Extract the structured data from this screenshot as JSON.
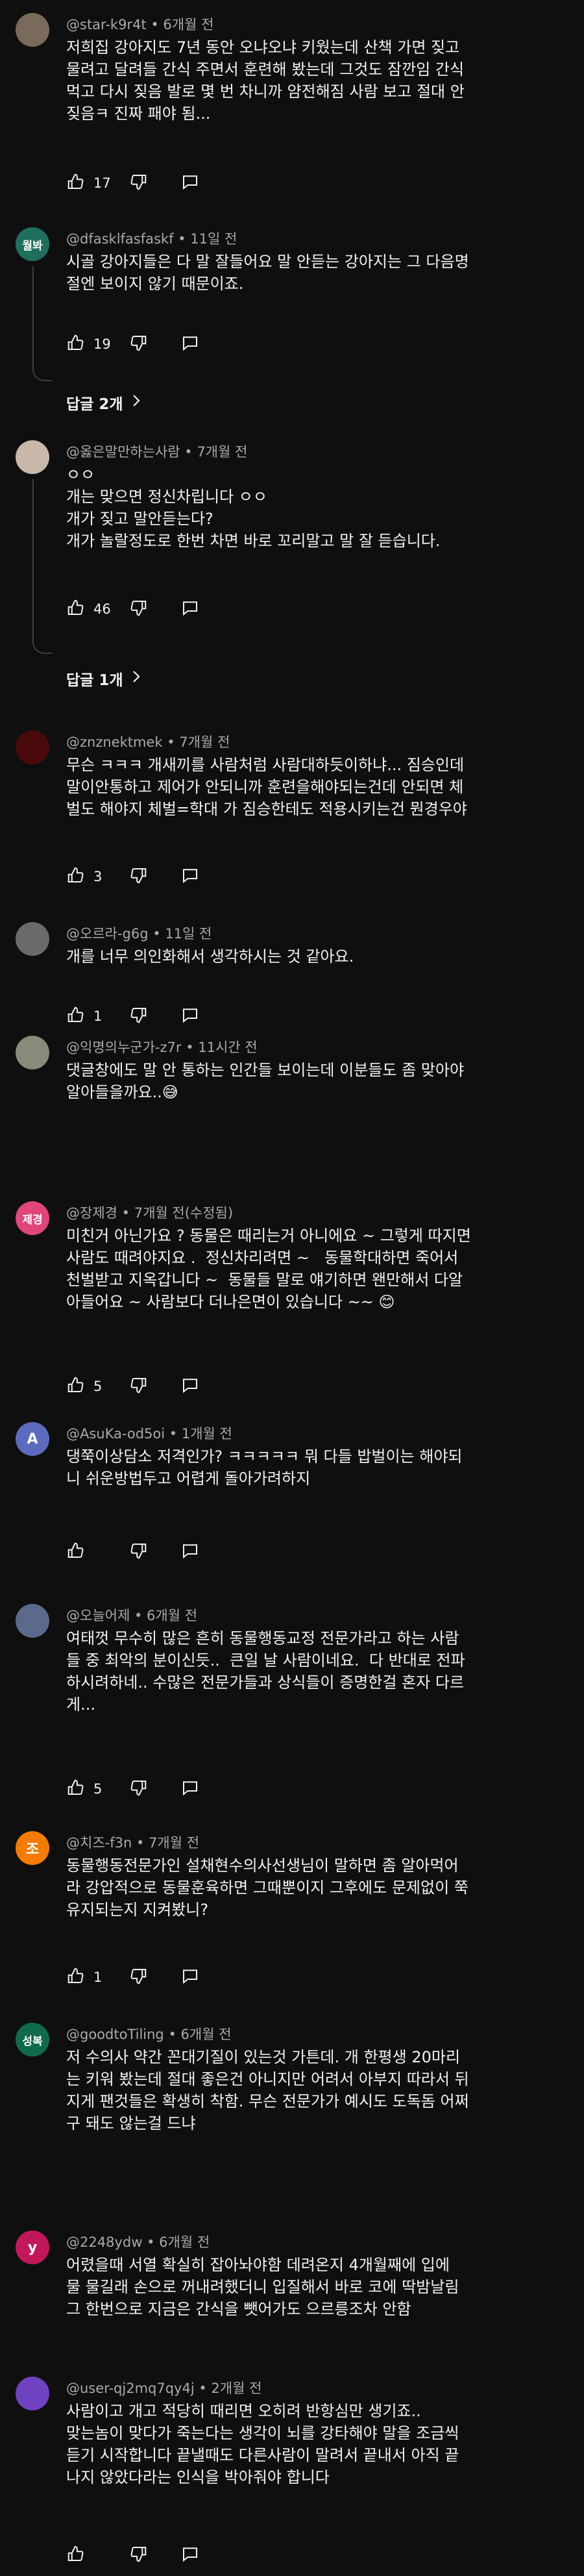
{
  "comments": [
    {
      "author": "@star-k9r4t",
      "time": "6개월 전",
      "avatar_text": "",
      "avatar_color": "#7a6a5a",
      "text": "저희집 강아지도 7년 동안 오냐오냐 키웠는데 산책 가면 짖고\n물려고 달려들 간식 주면서 훈련해 봤는데 그것도 잠깐임 간식\n먹고 다시 짖음 발로 몇 번 차니까 얌전해짐 사람 보고 절대 안\n짖음ㅋ 진짜 패야 됨...",
      "likes": "17"
    },
    {
      "author": "@dfasklfasfaskf",
      "time": "11일 전",
      "avatar_text": "월봐",
      "avatar_color": "#1f6f5f",
      "text": "시골 강아지들은 다 말 잘들어요 말 안듣는 강아지는 그 다음명\n절엔 보이지 않기 때문이죠.",
      "likes": "19",
      "replies": "답글 2개"
    },
    {
      "author": "@옳은말만하는사람",
      "time": "7개월 전",
      "avatar_text": "",
      "avatar_color": "#c8b8a8",
      "text": "ㅇㅇ\n개는 맞으면 정신차립니다 ㅇㅇ\n개가 짖고 말안듣는다?\n개가 놀랄정도로 한번 차면 바로 꼬리말고 말 잘 듣습니다.",
      "likes": "46",
      "replies": "답글 1개"
    },
    {
      "author": "@znznektmek",
      "time": "7개월 전",
      "avatar_text": "",
      "avatar_color": "#4a0a0a",
      "text": "무슨 ㅋㅋㅋ 개새끼를 사람처럼 사람대하듯이하냐... 짐승인데\n말이안통하고 제어가 안되니까 훈련을해야되는건데 안되면 체\n벌도 해야지 체벌=학대 가 짐승한테도 적용시키는건 뭔경우야",
      "likes": "3"
    },
    {
      "author": "@오르라-g6g",
      "time": "11일 전",
      "avatar_text": "",
      "avatar_color": "#6a6a6a",
      "text": "개를 너무 의인화해서 생각하시는 것 같아요.",
      "likes": "1"
    },
    {
      "author": "@익명의누군가-z7r",
      "time": "11시간 전",
      "avatar_text": "",
      "avatar_color": "#8a8a7a",
      "text": "댓글창에도 말 안 통하는 인간들 보이는데 이분들도 좀 맞아야\n알아들을까요..😅",
      "likes": ""
    },
    {
      "author": "@장제경",
      "time": "7개월 전(수정됨)",
      "avatar_text": "제경",
      "avatar_color": "#e0457b",
      "text": "미친거 아닌가요 ? 동물은 때리는거 아니에요 ~ 그렇게 따지면\n사람도 때려야지요 .  정신차리려면 ~   동물학대하면 죽어서\n천벌받고 지옥갑니다 ~  동물들 말로 얘기하면 왠만해서 다알\n아들어요 ~ 사람보다 더나은면이 있습니다 ~~ 😊",
      "likes": "5"
    },
    {
      "author": "@AsuKa-od5oi",
      "time": "1개월 전",
      "avatar_text": "A",
      "avatar_color": "#5c6bc0",
      "text": "댕쭉이상담소 저격인가? ㅋㅋㅋㅋㅋ 뭐 다들 밥벌이는 해야되\n니 쉬운방법두고 어렵게 돌아가려하지",
      "likes": ""
    },
    {
      "author": "@오늘어제",
      "time": "6개월 전",
      "avatar_text": "",
      "avatar_color": "#5a6a8a",
      "text": "여태껏 무수히 많은 흔히 동물행동교정 전문가라고 하는 사람\n들 중 최악의 분이신듯..  큰일 날 사람이네요.  다 반대로 전파\n하시려하네.. 수많은 전문가들과 상식들이 증명한걸 혼자 다르\n게...",
      "likes": "5"
    },
    {
      "author": "@치즈-f3n",
      "time": "7개월 전",
      "avatar_text": "조",
      "avatar_color": "#f57c00",
      "text": "동물행동전문가인 설채현수의사선생님이 말하면 좀 알아먹어\n라 강압적으로 동물훈육하면 그때뿐이지 그후에도 문제없이 쭉\n유지되는지 지켜봤니?",
      "likes": "1"
    },
    {
      "author": "@goodtoTiling",
      "time": "6개월 전",
      "avatar_text": "성복",
      "avatar_color": "#0f6b4a",
      "text": "저 수의사 약간 꼰대기질이 있는것 가튼데. 개 한평생 20마리\n는 키워 봤는데 절대 좋은건 아니지만 어려서 아부지 따라서 뒤\n지게 팬것들은 확생히 착함. 무슨 전문가가 예시도 도독돔 어쩌\n구 돼도 않는걸 드냐",
      "likes": ""
    },
    {
      "author": "@2248ydw",
      "time": "6개월 전",
      "avatar_text": "y",
      "avatar_color": "#c2185b",
      "text": "어렸을때 서열 확실히 잡아놔야함 데려온지 4개월째에 입에\n물 물길래 손으로 꺼내려했더니 입질해서 바로 코에 딱밤날림\n그 한번으로 지금은 간식을 뺏어가도 으르릉조차 안함",
      "likes": ""
    },
    {
      "author": "@user-qj2mq7qy4j",
      "time": "2개월 전",
      "avatar_text": "",
      "avatar_color": "#6f42c1",
      "text": "사람이고 개고 적당히 때리면 오히려 반항심만 생기죠..\n맞는놈이 맞다가 죽는다는 생각이 뇌를 강타해야 말을 조금씩\n듣기 시작합니다 끝낼때도 다른사람이 말려서 끝내서 아직 끝\n나지 않았다라는 인식을 박아줘야 합니다",
      "likes": ""
    }
  ]
}
